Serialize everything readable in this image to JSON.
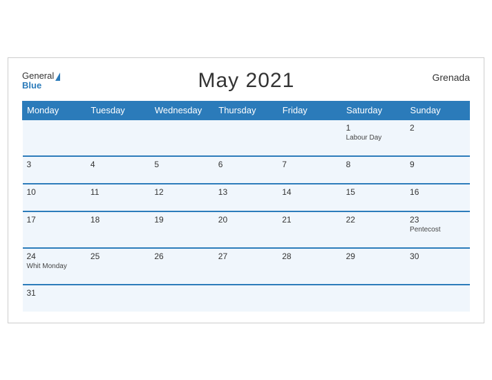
{
  "header": {
    "logo_general": "General",
    "logo_blue": "Blue",
    "title": "May 2021",
    "country": "Grenada"
  },
  "weekdays": [
    "Monday",
    "Tuesday",
    "Wednesday",
    "Thursday",
    "Friday",
    "Saturday",
    "Sunday"
  ],
  "weeks": [
    [
      {
        "day": "",
        "holiday": ""
      },
      {
        "day": "",
        "holiday": ""
      },
      {
        "day": "",
        "holiday": ""
      },
      {
        "day": "",
        "holiday": ""
      },
      {
        "day": "",
        "holiday": ""
      },
      {
        "day": "1",
        "holiday": "Labour Day"
      },
      {
        "day": "2",
        "holiday": ""
      }
    ],
    [
      {
        "day": "3",
        "holiday": ""
      },
      {
        "day": "4",
        "holiday": ""
      },
      {
        "day": "5",
        "holiday": ""
      },
      {
        "day": "6",
        "holiday": ""
      },
      {
        "day": "7",
        "holiday": ""
      },
      {
        "day": "8",
        "holiday": ""
      },
      {
        "day": "9",
        "holiday": ""
      }
    ],
    [
      {
        "day": "10",
        "holiday": ""
      },
      {
        "day": "11",
        "holiday": ""
      },
      {
        "day": "12",
        "holiday": ""
      },
      {
        "day": "13",
        "holiday": ""
      },
      {
        "day": "14",
        "holiday": ""
      },
      {
        "day": "15",
        "holiday": ""
      },
      {
        "day": "16",
        "holiday": ""
      }
    ],
    [
      {
        "day": "17",
        "holiday": ""
      },
      {
        "day": "18",
        "holiday": ""
      },
      {
        "day": "19",
        "holiday": ""
      },
      {
        "day": "20",
        "holiday": ""
      },
      {
        "day": "21",
        "holiday": ""
      },
      {
        "day": "22",
        "holiday": ""
      },
      {
        "day": "23",
        "holiday": "Pentecost"
      }
    ],
    [
      {
        "day": "24",
        "holiday": "Whit Monday"
      },
      {
        "day": "25",
        "holiday": ""
      },
      {
        "day": "26",
        "holiday": ""
      },
      {
        "day": "27",
        "holiday": ""
      },
      {
        "day": "28",
        "holiday": ""
      },
      {
        "day": "29",
        "holiday": ""
      },
      {
        "day": "30",
        "holiday": ""
      }
    ],
    [
      {
        "day": "31",
        "holiday": ""
      },
      {
        "day": "",
        "holiday": ""
      },
      {
        "day": "",
        "holiday": ""
      },
      {
        "day": "",
        "holiday": ""
      },
      {
        "day": "",
        "holiday": ""
      },
      {
        "day": "",
        "holiday": ""
      },
      {
        "day": "",
        "holiday": ""
      }
    ]
  ]
}
